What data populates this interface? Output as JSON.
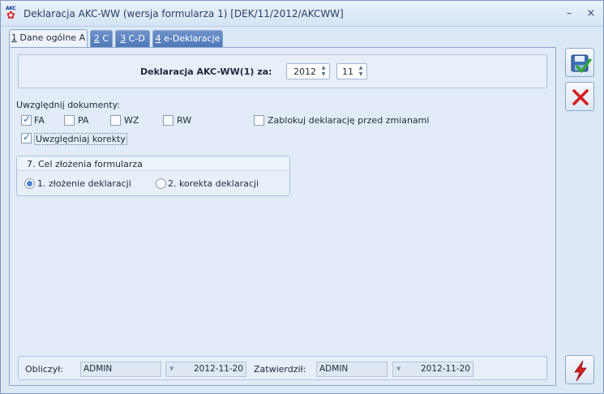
{
  "window": {
    "title": "Deklaracja AKC-WW (wersja formularza 1) [DEK/11/2012/AKCWW]",
    "icon_text": "AKC",
    "minimize_glyph": "–",
    "close_glyph": "×"
  },
  "tabs": [
    {
      "key": "1",
      "rest": " Dane ogólne A",
      "active": true
    },
    {
      "key": "2",
      "rest": " C",
      "active": false
    },
    {
      "key": "3",
      "rest": " C-D",
      "active": false
    },
    {
      "key": "4",
      "rest": " e-Deklaracje",
      "active": false
    }
  ],
  "declaration": {
    "label": "Deklaracja AKC-WW(1) za:",
    "year": "2012",
    "month": "11"
  },
  "documents": {
    "label": "Uwzględnij dokumenty:",
    "items": [
      {
        "label": "FA",
        "checked": true
      },
      {
        "label": "PA",
        "checked": false
      },
      {
        "label": "WZ",
        "checked": false
      },
      {
        "label": "RW",
        "checked": false
      }
    ],
    "lock_label": "Zablokuj deklarację przed zmianami",
    "lock_checked": false,
    "corrections_label": "Uwzględniaj korekty",
    "corrections_checked": true
  },
  "purpose": {
    "title": "7. Cel złożenia formularza",
    "options": [
      {
        "label": "1. złożenie deklaracji",
        "selected": true
      },
      {
        "label": "2. korekta deklaracji",
        "selected": false
      }
    ]
  },
  "footer": {
    "calculated_label": "Obliczył:",
    "calculated_user": "ADMIN",
    "calculated_date": "2012-11-20",
    "approved_label": "Zatwierdził:",
    "approved_user": "ADMIN",
    "approved_date": "2012-11-20"
  },
  "colors": {
    "accent": "#4f78b8",
    "save_green": "#2fa82f",
    "cancel_red": "#d42020"
  },
  "icons": {
    "save": "save-icon",
    "cancel": "cancel-icon",
    "calculate": "lightning-icon"
  }
}
